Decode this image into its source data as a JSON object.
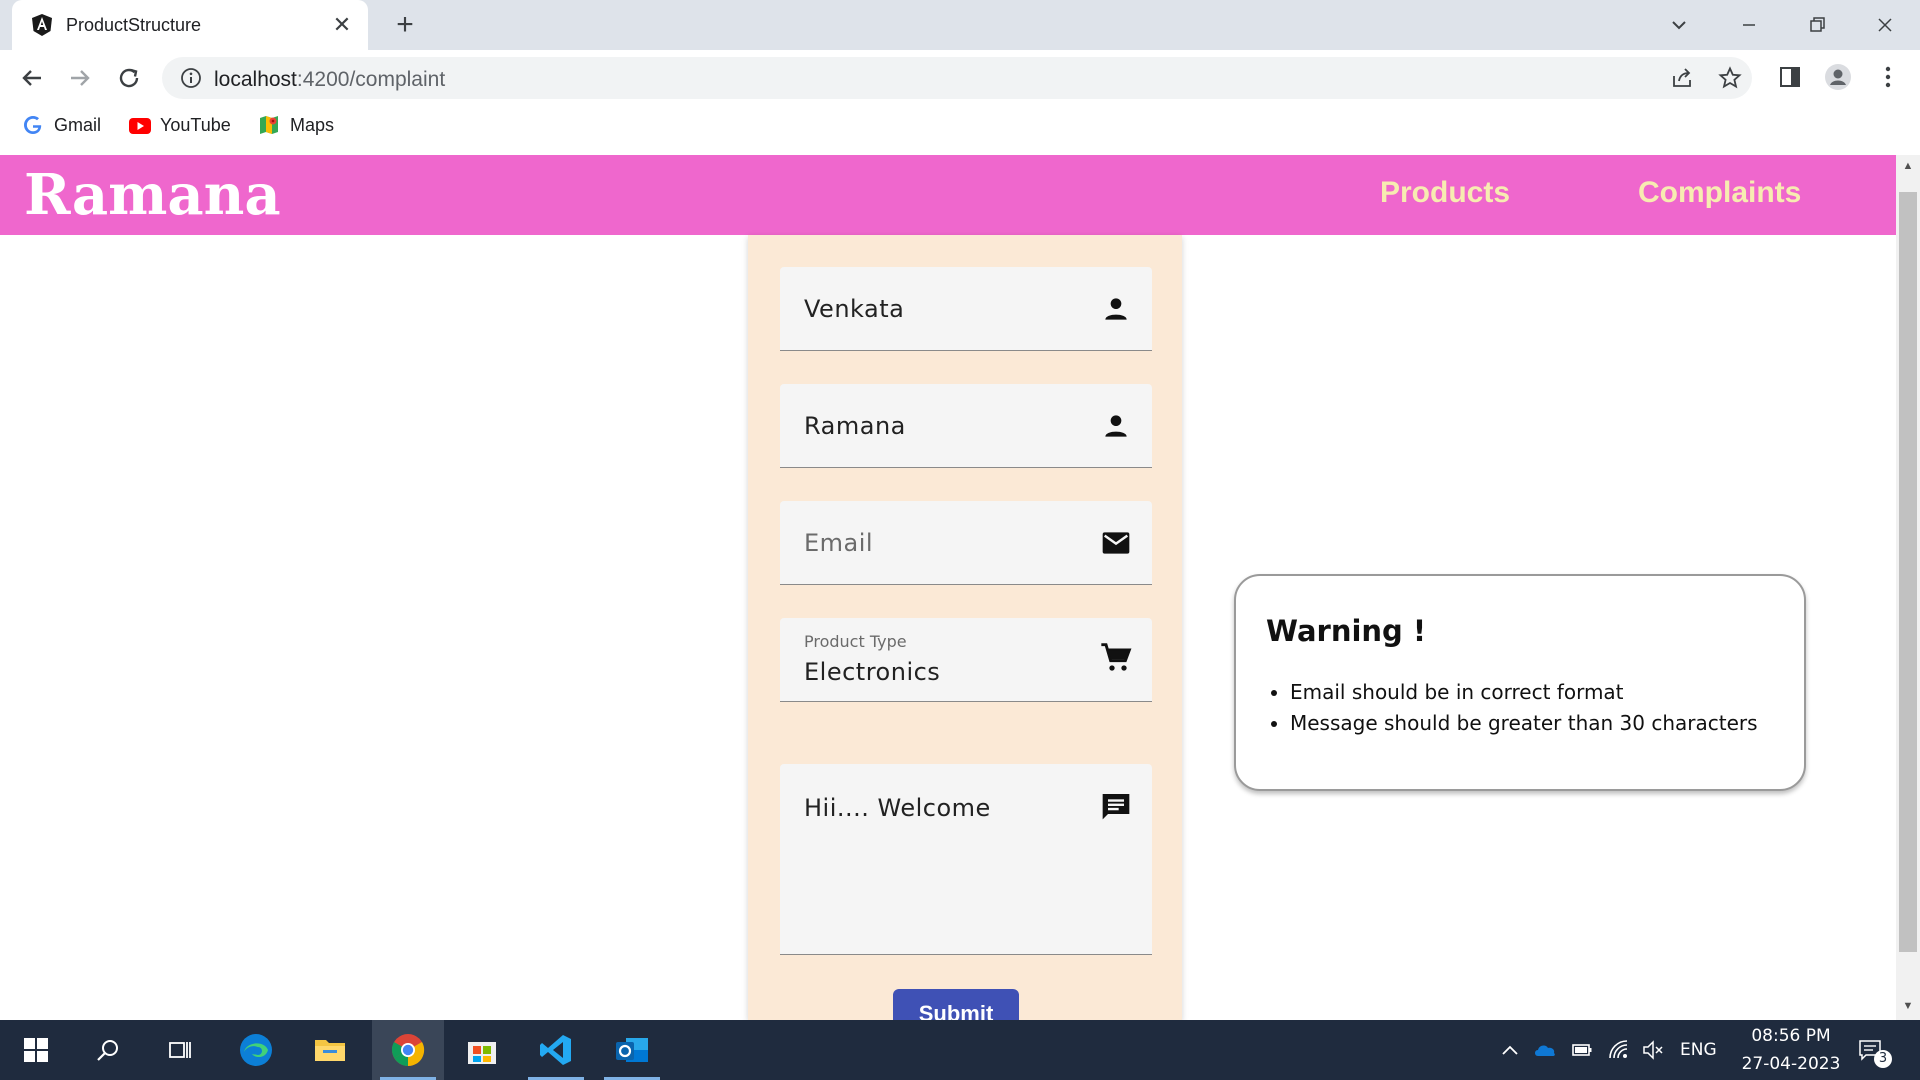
{
  "browser": {
    "tab_title": "ProductStructure",
    "url_host": "localhost",
    "url_rest": ":4200/complaint",
    "bookmarks": [
      {
        "label": "Gmail",
        "icon": "google-g-icon"
      },
      {
        "label": "YouTube",
        "icon": "youtube-icon"
      },
      {
        "label": "Maps",
        "icon": "maps-icon"
      }
    ]
  },
  "app": {
    "brand": "Ramana",
    "nav": {
      "products": "Products",
      "complaints": "Complaints"
    },
    "accent": "#ef67cd"
  },
  "form": {
    "first_name": "Venkata",
    "last_name": "Ramana",
    "email_placeholder": "Email",
    "product_type_label": "Product Type",
    "product_type_value": "Electronics",
    "message": "Hii.... Welcome",
    "submit_label": "Submit"
  },
  "warning": {
    "title": "Warning !",
    "items": [
      "Email should be in correct format",
      "Message should be greater than 30 characters"
    ]
  },
  "taskbar": {
    "language": "ENG",
    "time": "08:56 PM",
    "date": "27-04-2023",
    "notifications": "3"
  }
}
